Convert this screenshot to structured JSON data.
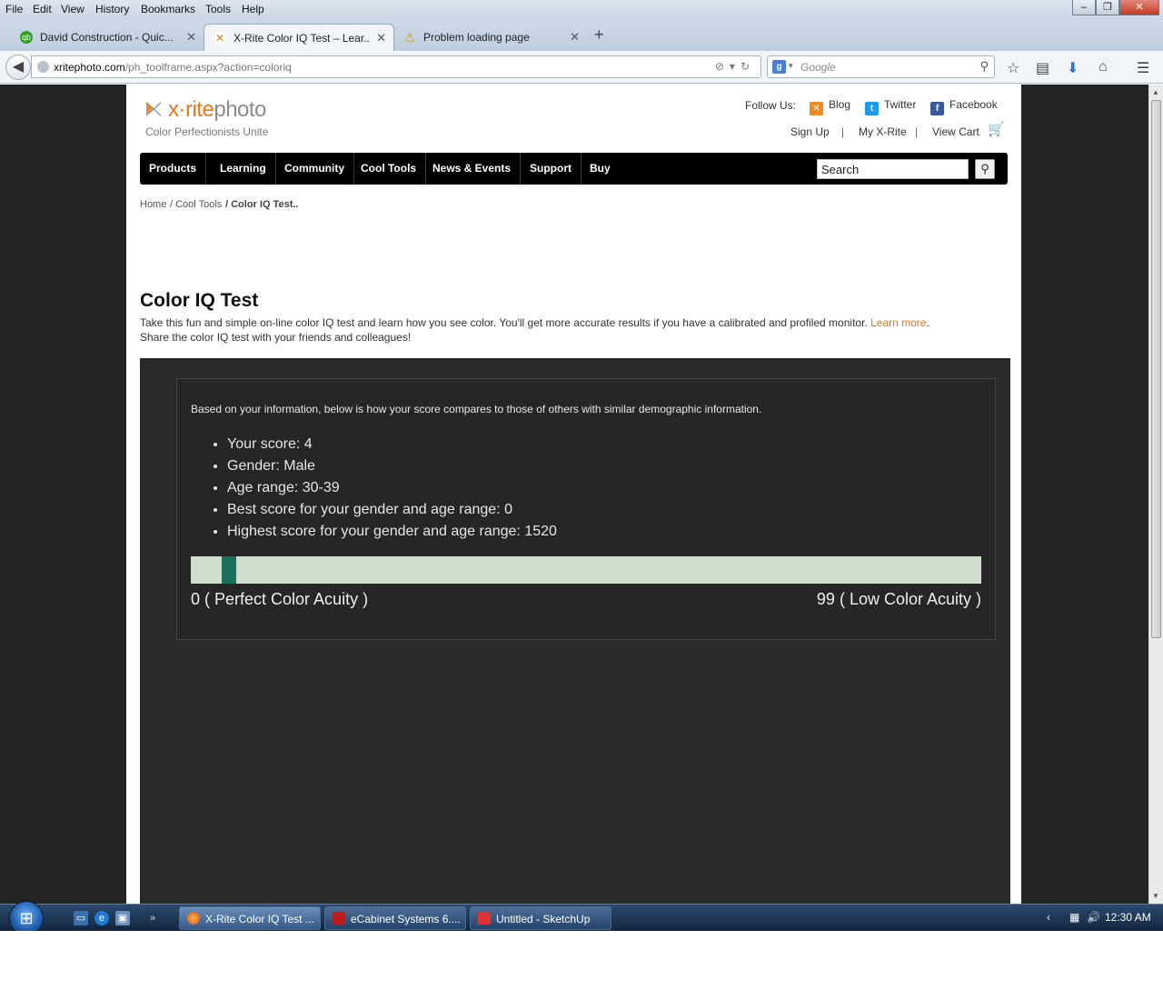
{
  "browser": {
    "menu": [
      "File",
      "Edit",
      "View",
      "History",
      "Bookmarks",
      "Tools",
      "Help"
    ],
    "tabs": [
      {
        "title": "David Construction - Quic..."
      },
      {
        "title": "X-Rite Color IQ Test – Lear..."
      },
      {
        "title": "Problem loading page"
      }
    ],
    "url_domain": "xritephoto.com",
    "url_path": "/ph_toolframe.aspx?action=coloriq",
    "search_placeholder": "Google"
  },
  "site": {
    "brand_main": "x·rite",
    "brand_sub": "photo",
    "tagline": "Color Perfectionists Unite",
    "follow_label": "Follow Us:",
    "social": [
      "Blog",
      "Twitter",
      "Facebook"
    ],
    "account": [
      "Sign Up",
      "My X-Rite",
      "View Cart"
    ],
    "nav": [
      "Products",
      "Learning",
      "Community",
      "Cool Tools",
      "News & Events",
      "Support",
      "Buy"
    ],
    "search_value": "Search"
  },
  "breadcrumb": {
    "home": "Home",
    "section": "/ Cool Tools",
    "current": "/ Color IQ Test.."
  },
  "content": {
    "title": "Color IQ Test",
    "intro_1": "Take this fun and simple on-line color IQ test and learn how you see color. You'll get more accurate results if you have a calibrated and profiled monitor.",
    "learn_more": "Learn more",
    "intro_period": ".",
    "intro_2": "Share the color IQ test with your friends and colleagues!",
    "compare_text": "Based on your information, below is how your score compares to those of others with similar demographic information.",
    "stats": [
      "Your score: 4",
      "Gender: Male",
      "Age range: 30-39",
      "Best score for your gender and age range: 0",
      "Highest score for your gender and age range: 1520"
    ],
    "score_fraction": 0.04,
    "scale_left": "0 ( Perfect Color Acuity )",
    "scale_right": "99 ( Low Color Acuity )",
    "colors": {
      "accent_orange": "#e27a1f",
      "bar_bg": "#d0dfcd",
      "marker": "#1d6f5e"
    }
  },
  "taskbar": {
    "tasks": [
      {
        "title": "X-Rite Color IQ Test ..."
      },
      {
        "title": "eCabinet Systems 6...."
      },
      {
        "title": "Untitled - SketchUp"
      }
    ],
    "clock": "12:30 AM"
  }
}
